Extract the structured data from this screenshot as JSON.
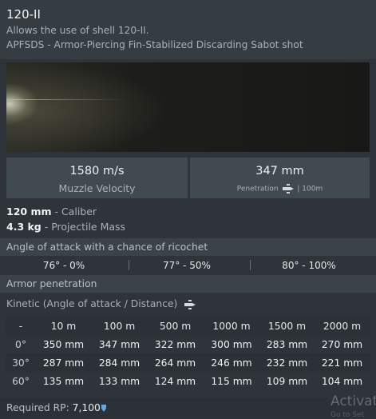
{
  "header": {
    "title": "120-II",
    "line1": "Allows the use of shell 120-II.",
    "line2": "APFSDS - Armor-Piercing Fin-Stabilized Discarding Sabot shot"
  },
  "stats": {
    "muzzle_velocity_value": "1580 m/s",
    "muzzle_velocity_label": "Muzzle Velocity",
    "penetration_value": "347 mm",
    "penetration_label": "Penetration",
    "penetration_note": "| 100m"
  },
  "properties": {
    "caliber_value": "120 mm",
    "caliber_label": " - Caliber",
    "mass_value": "4.3 kg",
    "mass_label": " - Projectile Mass"
  },
  "ricochet": {
    "title": "Angle of attack with a chance of ricochet",
    "entries": [
      "76° - 0%",
      "77° - 50%",
      "80° - 100%"
    ]
  },
  "penetration": {
    "title": "Armor penetration",
    "subtitle": "Kinetic (Angle of attack / Distance)",
    "columns": [
      "-",
      "10 m",
      "100 m",
      "500 m",
      "1000 m",
      "1500 m",
      "2000 m"
    ],
    "rows": [
      {
        "angle": "0°",
        "values": [
          "350 mm",
          "347 mm",
          "322 mm",
          "300 mm",
          "283 mm",
          "270 mm"
        ]
      },
      {
        "angle": "30°",
        "values": [
          "287 mm",
          "284 mm",
          "264 mm",
          "246 mm",
          "232 mm",
          "221 mm"
        ]
      },
      {
        "angle": "60°",
        "values": [
          "135 mm",
          "133 mm",
          "124 mm",
          "115 mm",
          "109 mm",
          "104 mm"
        ]
      }
    ]
  },
  "footer": {
    "rp_label": "Required RP: ",
    "rp_value": "7,100",
    "watermark": "Activat",
    "watermark_sub": "Go to Set"
  },
  "icons": {
    "shell_icon": "shell-icon",
    "rp_icon": "research-point-icon",
    "rp_icon_color": "#5fa8e6"
  }
}
